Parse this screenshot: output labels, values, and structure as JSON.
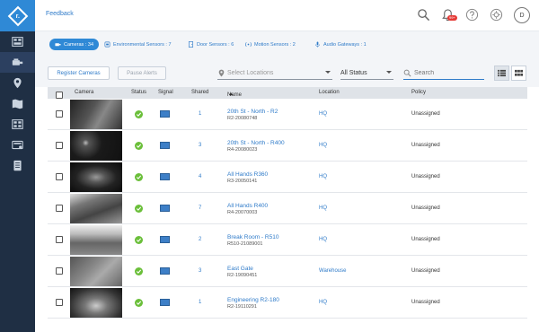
{
  "topbar": {
    "feedback": "Feedback",
    "notification_count": "99+",
    "avatar_initial": "D"
  },
  "tabs": [
    {
      "label": "Cameras : 34",
      "icon": "camera-icon",
      "active": true
    },
    {
      "label": "Environmental Sensors : 7",
      "icon": "sensor-icon",
      "active": false
    },
    {
      "label": "Door Sensors : 6",
      "icon": "door-icon",
      "active": false
    },
    {
      "label": "Motion Sensors : 2",
      "icon": "motion-icon",
      "active": false
    },
    {
      "label": "Audio Gateways : 1",
      "icon": "microphone-icon",
      "active": false
    }
  ],
  "toolbar": {
    "register_label": "Register Cameras",
    "pause_label": "Pause Alerts",
    "location_placeholder": "Select Locations",
    "status_value": "All Status",
    "search_placeholder": "Search"
  },
  "table": {
    "headers": {
      "camera": "Camera",
      "status": "Status",
      "signal": "Signal",
      "shared": "Shared",
      "name": "Name",
      "location": "Location",
      "policy": "Policy"
    },
    "rows": [
      {
        "shared": "1",
        "name": "20th St - North - R2",
        "serial": "R2-20080748",
        "location": "HQ",
        "policy": "Unassigned"
      },
      {
        "shared": "3",
        "name": "20th St - North - R400",
        "serial": "R4-20080023",
        "location": "HQ",
        "policy": "Unassigned"
      },
      {
        "shared": "4",
        "name": "All Hands R360",
        "serial": "R3-20050141",
        "location": "HQ",
        "policy": "Unassigned"
      },
      {
        "shared": "7",
        "name": "All Hands R400",
        "serial": "R4-20070003",
        "location": "HQ",
        "policy": "Unassigned"
      },
      {
        "shared": "2",
        "name": "Break Room - R510",
        "serial": "R510-21089001",
        "location": "HQ",
        "policy": "Unassigned"
      },
      {
        "shared": "3",
        "name": "East Gate",
        "serial": "R2-19090451",
        "location": "Warehouse",
        "policy": "Unassigned"
      },
      {
        "shared": "1",
        "name": "Engineering R2-180",
        "serial": "R2-19110291",
        "location": "HQ",
        "policy": "Unassigned"
      }
    ]
  },
  "colors": {
    "rail": "#1f2f44",
    "accent": "#2f89d6",
    "link": "#2f7bc9",
    "ok_status": "#6bbf3a",
    "badge": "#e53935"
  }
}
